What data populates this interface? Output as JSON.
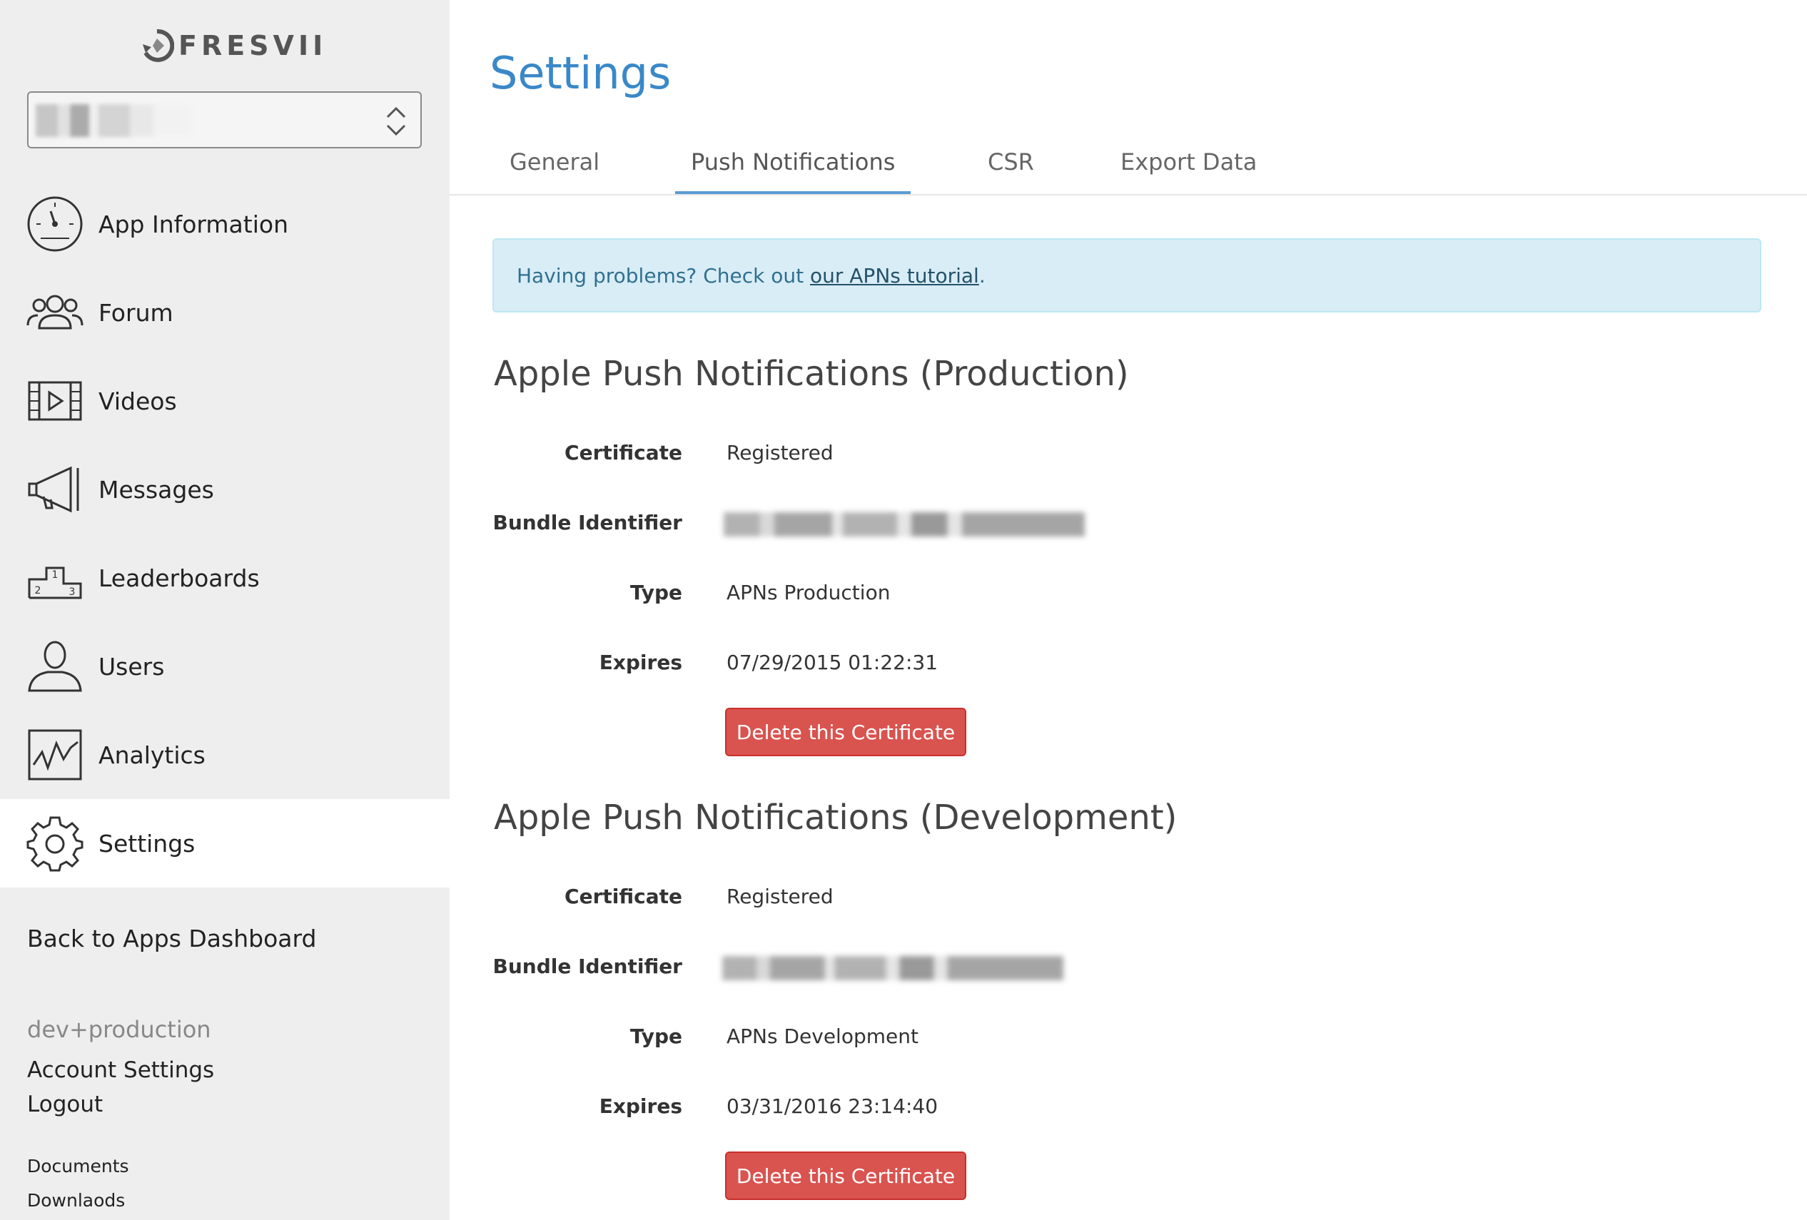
{
  "brand": {
    "logo_text": "FRESVII",
    "app_selector_value": ""
  },
  "sidebar": {
    "items": [
      {
        "label": "App Information",
        "icon": "dashboard-gauge-icon"
      },
      {
        "label": "Forum",
        "icon": "people-group-icon"
      },
      {
        "label": "Videos",
        "icon": "film-play-icon"
      },
      {
        "label": "Messages",
        "icon": "megaphone-icon"
      },
      {
        "label": "Leaderboards",
        "icon": "podium-icon"
      },
      {
        "label": "Users",
        "icon": "user-silhouette-icon"
      },
      {
        "label": "Analytics",
        "icon": "line-graph-icon"
      },
      {
        "label": "Settings",
        "icon": "gear-icon",
        "active": true
      }
    ],
    "back_link": "Back to Apps Dashboard",
    "user_name": "dev+production",
    "account_settings": "Account Settings",
    "logout": "Logout",
    "documents": "Documents",
    "downloads": "Downlaods"
  },
  "main": {
    "title": "Settings",
    "tabs": [
      {
        "label": "General"
      },
      {
        "label": "Push Notifications",
        "active": true
      },
      {
        "label": "CSR"
      },
      {
        "label": "Export Data"
      }
    ],
    "alert": {
      "text": "Having problems? Check out ",
      "link": "our APNs tutorial",
      "suffix": "."
    },
    "production": {
      "title": "Apple Push Notifications (Production)",
      "certificate_label": "Certificate",
      "certificate_value": "Registered",
      "bundle_label": "Bundle Identifier",
      "type_label": "Type",
      "type_value": "APNs Production",
      "expires_label": "Expires",
      "expires_value": "07/29/2015 01:22:31",
      "delete_label": "Delete this Certificate"
    },
    "development": {
      "title": "Apple Push Notifications (Development)",
      "certificate_label": "Certificate",
      "certificate_value": "Registered",
      "bundle_label": "Bundle Identifier",
      "type_label": "Type",
      "type_value": "APNs Development",
      "expires_label": "Expires",
      "expires_value": "03/31/2016 23:14:40",
      "delete_label": "Delete this Certificate"
    }
  },
  "colors": {
    "accent": "#3a88c8",
    "danger": "#d9533f",
    "sidebar_bg": "#eeeeee",
    "alert_bg": "#d9edf7"
  }
}
